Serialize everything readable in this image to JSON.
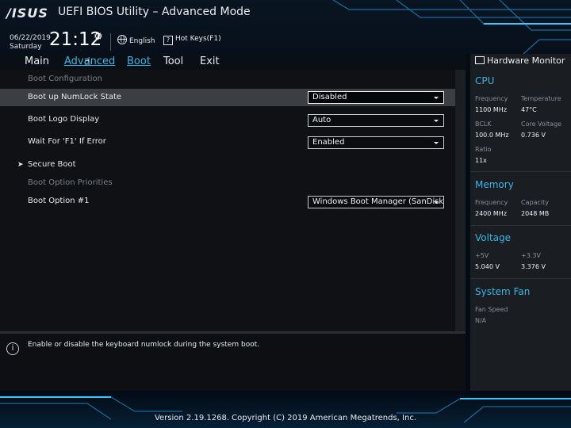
{
  "header": {
    "logo": "/ISUS",
    "title": "UEFI BIOS Utility – Advanced Mode",
    "date": "06/22/2019",
    "day": "Saturday",
    "time": "21:12",
    "language": "English",
    "hotkeys": "Hot Keys(F1)",
    "hotkeys_icon_text": "?"
  },
  "menu": {
    "items": [
      "Main",
      "Advanced",
      "Boot",
      "Tool",
      "Exit"
    ],
    "active": "Boot"
  },
  "boot": {
    "section_config": "Boot Configuration",
    "numlock": {
      "label": "Boot up NumLock State",
      "value": "Disabled"
    },
    "logo": {
      "label": "Boot Logo Display",
      "value": "Auto"
    },
    "f1": {
      "label": "Wait For 'F1' If Error",
      "value": "Enabled"
    },
    "secure_boot": "Secure Boot",
    "section_priorities": "Boot Option Priorities",
    "option1": {
      "label": "Boot Option #1",
      "value": "Windows Boot Manager (SanDisk"
    }
  },
  "help_text": "Enable or disable the keyboard numlock during the system boot.",
  "hardware_monitor": {
    "title": "Hardware Monitor",
    "cpu": {
      "heading": "CPU",
      "frequency_label": "Frequency",
      "frequency": "1100 MHz",
      "temperature_label": "Temperature",
      "temperature": "47°C",
      "bclk_label": "BCLK",
      "bclk": "100.0 MHz",
      "core_voltage_label": "Core Voltage",
      "core_voltage": "0.736 V",
      "ratio_label": "Ratio",
      "ratio": "11x"
    },
    "memory": {
      "heading": "Memory",
      "frequency_label": "Frequency",
      "frequency": "2400 MHz",
      "capacity_label": "Capacity",
      "capacity": "2048 MB"
    },
    "voltage": {
      "heading": "Voltage",
      "v5_label": "+5V",
      "v5": "5.040 V",
      "v33_label": "+3.3V",
      "v33": "3.376 V"
    },
    "fan": {
      "heading": "System Fan",
      "speed_label": "Fan Speed",
      "speed": "N/A"
    }
  },
  "footer": "Version 2.19.1268. Copyright (C) 2019 American Megatrends, Inc.",
  "colors": {
    "accent": "#3cb5e6",
    "highlight_row": "#3b3e42",
    "background": "#0f1115"
  }
}
